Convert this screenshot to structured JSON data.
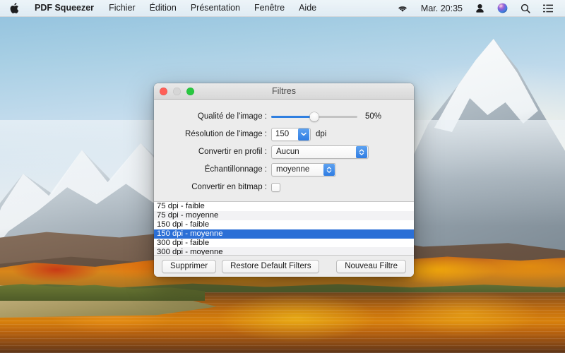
{
  "menubar": {
    "apple_icon": "apple-logo-icon",
    "app_name": "PDF Squeezer",
    "items": [
      "Fichier",
      "Édition",
      "Présentation",
      "Fenêtre",
      "Aide"
    ],
    "status": {
      "wifi_icon": "wifi-icon",
      "clock": "Mar. 20:35",
      "user_icon": "user-account-icon",
      "siri_icon": "siri-icon",
      "search_icon": "spotlight-search-icon",
      "notifications_icon": "notification-center-icon"
    }
  },
  "window": {
    "title": "Filtres",
    "traffic_lights": {
      "close": "close-button",
      "minimize": "minimize-button",
      "zoom": "zoom-button"
    },
    "form": {
      "quality": {
        "label": "Qualité de l'image :",
        "value_text": "50%",
        "value": 50,
        "min": 0,
        "max": 100
      },
      "resolution": {
        "label": "Résolution de l'image :",
        "value": "150",
        "unit": "dpi"
      },
      "profile": {
        "label": "Convertir en profil :",
        "value": "Aucun"
      },
      "sampling": {
        "label": "Échantillonnage :",
        "value": "moyenne"
      },
      "bitmap": {
        "label": "Convertir en bitmap :",
        "checked": false
      }
    },
    "filter_list": [
      "75 dpi - faible",
      "75 dpi - moyenne",
      "150 dpi - faible",
      "150 dpi - moyenne",
      "300 dpi - faible",
      "300 dpi - moyenne"
    ],
    "selected_filter_index": 3,
    "empty_row_count": 4,
    "footer": {
      "delete_label": "Supprimer",
      "restore_label": "Restore Default Filters",
      "new_label": "Nouveau Filtre"
    }
  },
  "colors": {
    "accent": "#2b6fd6",
    "slider_fill": "#2f7fe0",
    "popup_arrow": "#2f7de3",
    "traffic_red": "#ff5f57",
    "traffic_yellow": "#d6d6d6",
    "traffic_green": "#28c840"
  }
}
